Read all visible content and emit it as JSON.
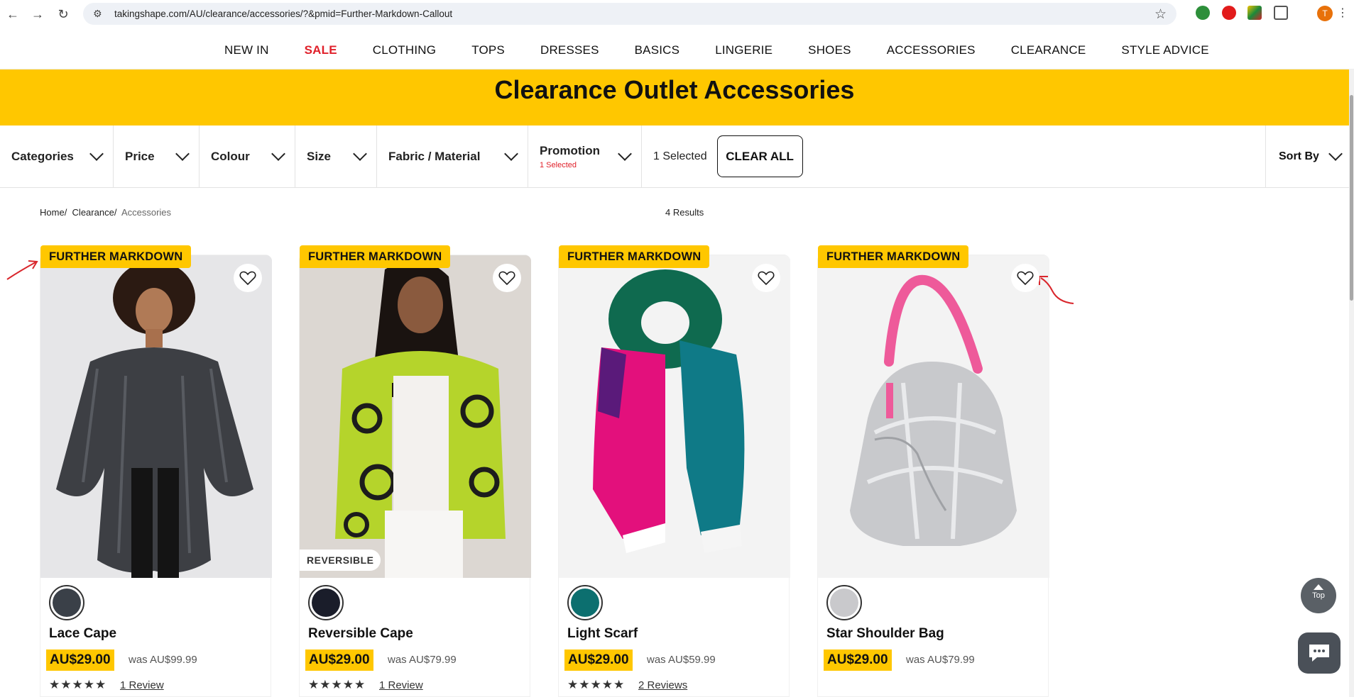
{
  "browser": {
    "url": "takingshape.com/AU/clearance/accessories/?&pmid=Further-Markdown-Callout",
    "profile_initial": "T"
  },
  "nav": {
    "items": [
      {
        "label": "NEW IN"
      },
      {
        "label": "SALE"
      },
      {
        "label": "CLOTHING"
      },
      {
        "label": "TOPS"
      },
      {
        "label": "DRESSES"
      },
      {
        "label": "BASICS"
      },
      {
        "label": "LINGERIE"
      },
      {
        "label": "SHOES"
      },
      {
        "label": "ACCESSORIES"
      },
      {
        "label": "CLEARANCE"
      },
      {
        "label": "STYLE ADVICE"
      }
    ],
    "sale_color": "#e0202a"
  },
  "banner": {
    "title": "Clearance Outlet Accessories",
    "color": "#ffc700"
  },
  "filters": {
    "categories": "Categories",
    "price": "Price",
    "colour": "Colour",
    "size": "Size",
    "fabric": "Fabric / Material",
    "promotion": "Promotion",
    "promotion_sub": "1 Selected",
    "selected": "1 Selected",
    "clear_all": "CLEAR ALL",
    "sort": "Sort By"
  },
  "breadcrumb": {
    "home": "Home",
    "clearance": "Clearance",
    "current": "Accessories",
    "sep": "/"
  },
  "results": "4 Results",
  "products": [
    {
      "badge": "FURTHER MARKDOWN",
      "name": "Lace Cape",
      "price": "AU$29.00",
      "was": "was AU$99.99",
      "reviews": "1 Review",
      "stars": "★★★★★",
      "swatch": "#3a4048"
    },
    {
      "badge": "FURTHER MARKDOWN",
      "name": "Reversible Cape",
      "price": "AU$29.00",
      "was": "was AU$79.99",
      "reviews": "1 Review",
      "stars": "★★★★★",
      "swatch": "#1a1d2a",
      "tag": "REVERSIBLE"
    },
    {
      "badge": "FURTHER MARKDOWN",
      "name": "Light Scarf",
      "price": "AU$29.00",
      "was": "was AU$59.99",
      "reviews": "2 Reviews",
      "stars": "★★★★★",
      "swatch": "#0c6f6f"
    },
    {
      "badge": "FURTHER MARKDOWN",
      "name": "Star Shoulder Bag",
      "price": "AU$29.00",
      "was": "was AU$79.99",
      "swatch": "#c9c9cc"
    }
  ],
  "floating": {
    "top_label": "Top"
  }
}
